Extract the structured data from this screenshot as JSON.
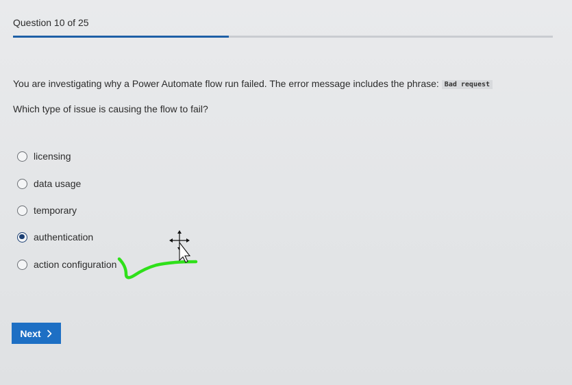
{
  "progress": {
    "title": "Question 10 of 25",
    "fraction": 0.4
  },
  "question": {
    "text": "You are investigating why a Power Automate flow run failed. The error message includes the phrase:",
    "code": "Bad request",
    "prompt": "Which type of issue is causing the flow to fail?"
  },
  "options": [
    {
      "label": "licensing",
      "selected": false
    },
    {
      "label": "data usage",
      "selected": false
    },
    {
      "label": "temporary",
      "selected": false
    },
    {
      "label": "authentication",
      "selected": true
    },
    {
      "label": "action configuration",
      "selected": false
    }
  ],
  "navigation": {
    "next_label": "Next"
  },
  "colors": {
    "accent": "#1d6fc4",
    "progress": "#1d5fa6",
    "selected_radio": "#1b3f73",
    "annotation_stroke": "#2fe01a"
  },
  "icons": {
    "next_chevron": "chevron-right-icon",
    "cursor": "move-cursor-icon"
  }
}
